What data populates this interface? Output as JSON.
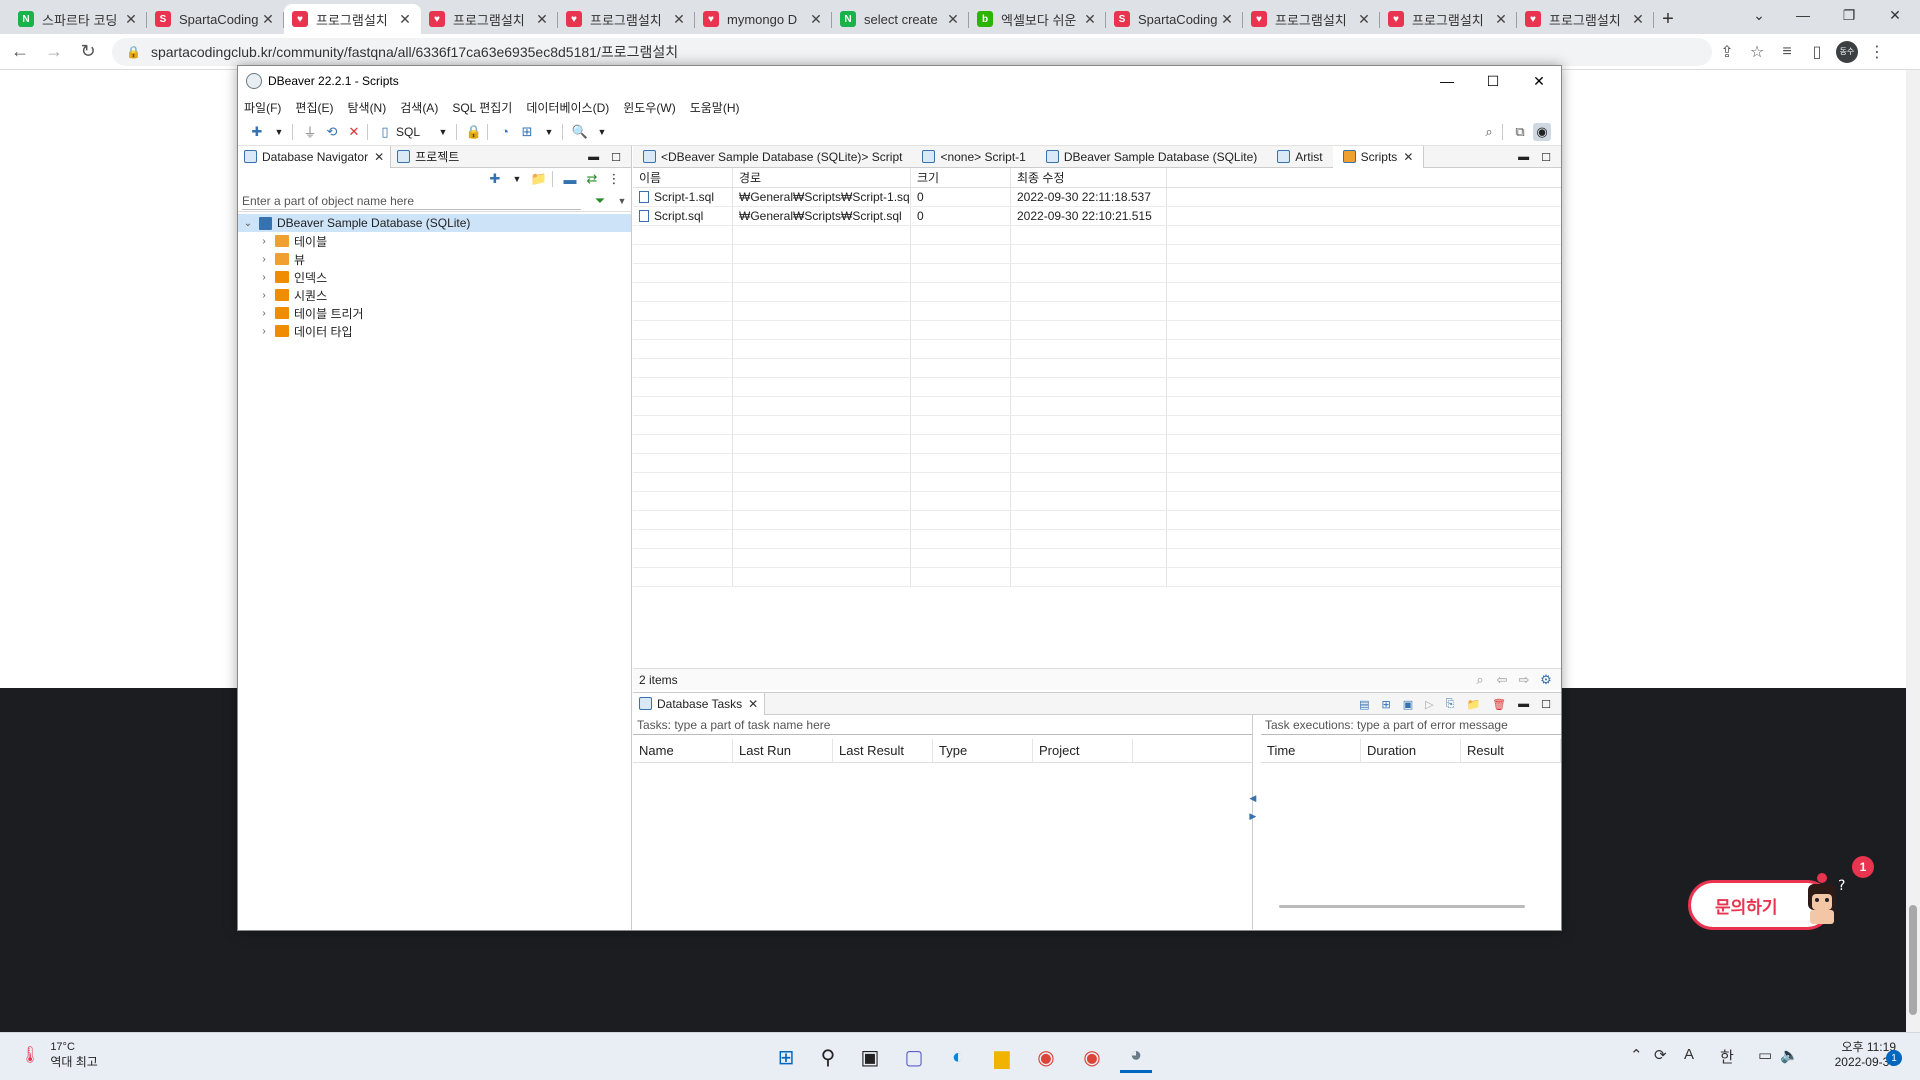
{
  "browser": {
    "tabs": [
      {
        "title": "스파르타 코딩",
        "fav_color": "#19b24b",
        "fav_glyph": "N"
      },
      {
        "title": "SpartaCoding",
        "fav_color": "#e8344e",
        "fav_glyph": "S"
      },
      {
        "title": "프로그램설치",
        "fav_color": "#e8344e",
        "fav_glyph": "♥",
        "active": true
      },
      {
        "title": "프로그램설치",
        "fav_color": "#e8344e",
        "fav_glyph": "♥"
      },
      {
        "title": "프로그램설치",
        "fav_color": "#e8344e",
        "fav_glyph": "♥"
      },
      {
        "title": "mymongo D",
        "fav_color": "#e8344e",
        "fav_glyph": "♥"
      },
      {
        "title": "select create",
        "fav_color": "#19b24b",
        "fav_glyph": "N"
      },
      {
        "title": "엑셀보다 쉬운",
        "fav_color": "#2db400",
        "fav_glyph": "b"
      },
      {
        "title": "SpartaCoding",
        "fav_color": "#e8344e",
        "fav_glyph": "S"
      },
      {
        "title": "프로그램설치",
        "fav_color": "#e8344e",
        "fav_glyph": "♥"
      },
      {
        "title": "프로그램설치",
        "fav_color": "#e8344e",
        "fav_glyph": "♥"
      },
      {
        "title": "프로그램설치",
        "fav_color": "#e8344e",
        "fav_glyph": "♥"
      }
    ],
    "url": "spartacodingclub.kr/community/fastqna/all/6336f17ca63e6935ec8d5181/프로그램설치",
    "profile": "동수"
  },
  "page": {
    "inquiry_label": "문의하기",
    "badge_count": "1"
  },
  "dbeaver": {
    "title": "DBeaver 22.2.1 - Scripts",
    "menu": [
      "파일(F)",
      "편집(E)",
      "탐색(N)",
      "검색(A)",
      "SQL 편집기",
      "데이터베이스(D)",
      "윈도우(W)",
      "도움말(H)"
    ],
    "toolbar_sql": "SQL",
    "left_tabs": {
      "navigator": "Database Navigator",
      "project": "프로젝트"
    },
    "filter_placeholder": "Enter a part of object name here",
    "tree_root": "DBeaver Sample Database (SQLite)",
    "tree_children": [
      {
        "label": "테이블",
        "color": "#f0a030"
      },
      {
        "label": "뷰",
        "color": "#f0a030"
      },
      {
        "label": "인덱스",
        "color": "#f08c00"
      },
      {
        "label": "시퀀스",
        "color": "#f08c00"
      },
      {
        "label": "테이블 트리거",
        "color": "#f08c00"
      },
      {
        "label": "데이터 타입",
        "color": "#f08c00"
      }
    ],
    "editor_tabs": [
      "<DBeaver Sample Database (SQLite)> Script",
      "<none> Script-1",
      "DBeaver Sample Database (SQLite)",
      "Artist",
      "Scripts"
    ],
    "scripts_table": {
      "columns": [
        "이름",
        "경로",
        "크기",
        "최종 수정"
      ],
      "rows": [
        [
          "Script-1.sql",
          "₩General₩Scripts₩Script-1.sql",
          "0",
          "2022-09-30 22:11:18.537"
        ],
        [
          "Script.sql",
          "₩General₩Scripts₩Script.sql",
          "0",
          "2022-09-30 22:10:21.515"
        ]
      ],
      "count": "2 items"
    },
    "tasks": {
      "tab": "Database Tasks",
      "filter_placeholder": "Tasks: type a part of task name here",
      "exec_placeholder": "Task executions: type a part of error message",
      "columns": [
        "Name",
        "Last Run",
        "Last Result",
        "Type",
        "Project"
      ],
      "exec_columns": [
        "Time",
        "Duration",
        "Result"
      ]
    }
  },
  "taskbar": {
    "weather_temp": "17°C",
    "weather_desc": "역대 최고",
    "time": "오후 11:19",
    "date": "2022-09-30",
    "ime": "한",
    "lang": "A",
    "notif": "1"
  }
}
